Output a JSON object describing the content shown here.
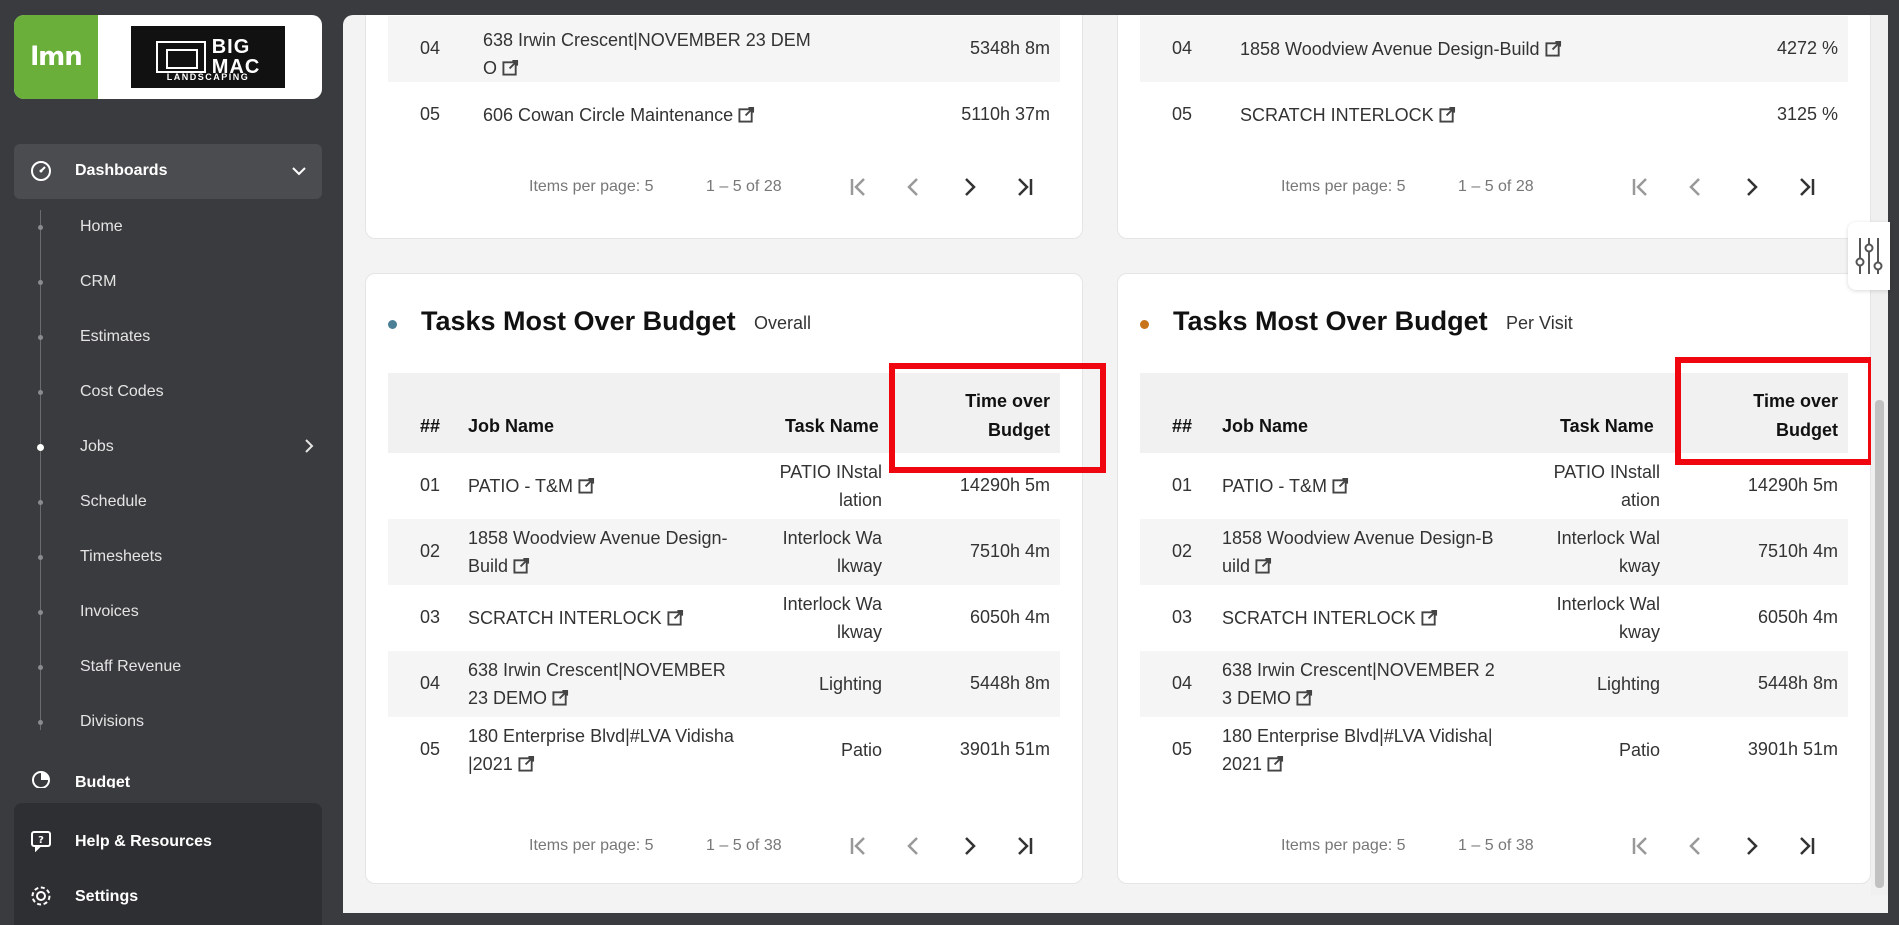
{
  "brand": {
    "lmn_logo": "lmn",
    "company_logo_line1": "BIG",
    "company_logo_line2": "MAC",
    "company_logo_sub": "LANDSCAPING"
  },
  "sidebar": {
    "dashboards_label": "Dashboards",
    "items": [
      {
        "label": "Home"
      },
      {
        "label": "CRM"
      },
      {
        "label": "Estimates"
      },
      {
        "label": "Cost Codes"
      },
      {
        "label": "Jobs"
      },
      {
        "label": "Schedule"
      },
      {
        "label": "Timesheets"
      },
      {
        "label": "Invoices"
      },
      {
        "label": "Staff Revenue"
      },
      {
        "label": "Divisions"
      }
    ],
    "budget_label": "Budget",
    "help_label": "Help & Resources",
    "settings_label": "Settings"
  },
  "top_left": {
    "rows": [
      {
        "num": "04",
        "job_l1": "638 Irwin Crescent|NOVEMBER 23 DEM",
        "job_l2": "O",
        "value": "5348h 8m"
      },
      {
        "num": "05",
        "job": "606 Cowan Circle Maintenance",
        "value": "5110h 37m"
      }
    ],
    "pager": {
      "items_per_page": "Items per page: 5",
      "range": "1 – 5 of 28"
    }
  },
  "top_right": {
    "rows": [
      {
        "num": "04",
        "job": "1858 Woodview Avenue Design-Build",
        "value": "4272 %"
      },
      {
        "num": "05",
        "job": "SCRATCH INTERLOCK",
        "value": "3125 %"
      }
    ],
    "pager": {
      "items_per_page": "Items per page: 5",
      "range": "1 – 5 of 28"
    }
  },
  "overall": {
    "title": "Tasks Most Over Budget",
    "subtitle": "Overall",
    "dot_color": "#4a7f95",
    "headers": {
      "num": "##",
      "job": "Job Name",
      "task": "Task Name",
      "time_l1": "Time over",
      "time_l2": "Budget"
    },
    "rows": [
      {
        "num": "01",
        "job_l1": "PATIO - T&M",
        "job_l2": "",
        "task_l1": "PATIO INstal",
        "task_l2": "lation",
        "value": "14290h 5m"
      },
      {
        "num": "02",
        "job_l1": "1858 Woodview Avenue Design-",
        "job_l2": "Build",
        "task_l1": "Interlock Wa",
        "task_l2": "lkway",
        "value": "7510h 4m"
      },
      {
        "num": "03",
        "job_l1": "SCRATCH INTERLOCK",
        "job_l2": "",
        "task_l1": "Interlock Wa",
        "task_l2": "lkway",
        "value": "6050h 4m"
      },
      {
        "num": "04",
        "job_l1": "638 Irwin Crescent|NOVEMBER",
        "job_l2": "23 DEMO",
        "task_l1": "Lighting",
        "task_l2": "",
        "value": "5448h 8m"
      },
      {
        "num": "05",
        "job_l1": "180 Enterprise Blvd|#LVA Vidisha",
        "job_l2": "|2021",
        "task_l1": "Patio",
        "task_l2": "",
        "value": "3901h 51m"
      }
    ],
    "pager": {
      "items_per_page": "Items per page: 5",
      "range": "1 – 5 of 38"
    }
  },
  "per_visit": {
    "title": "Tasks Most Over Budget",
    "subtitle": "Per Visit",
    "dot_color": "#c8731a",
    "headers": {
      "num": "##",
      "job": "Job Name",
      "task": "Task Name",
      "time_l1": "Time over",
      "time_l2": "Budget"
    },
    "rows": [
      {
        "num": "01",
        "job_l1": "PATIO - T&M",
        "job_l2": "",
        "task_l1": "PATIO INstall",
        "task_l2": "ation",
        "value": "14290h 5m"
      },
      {
        "num": "02",
        "job_l1": "1858 Woodview Avenue Design-B",
        "job_l2": "uild",
        "task_l1": "Interlock Wal",
        "task_l2": "kway",
        "value": "7510h 4m"
      },
      {
        "num": "03",
        "job_l1": "SCRATCH INTERLOCK",
        "job_l2": "",
        "task_l1": "Interlock Wal",
        "task_l2": "kway",
        "value": "6050h 4m"
      },
      {
        "num": "04",
        "job_l1": "638 Irwin Crescent|NOVEMBER 2",
        "job_l2": "3 DEMO",
        "task_l1": "Lighting",
        "task_l2": "",
        "value": "5448h 8m"
      },
      {
        "num": "05",
        "job_l1": "180 Enterprise Blvd|#LVA Vidisha|",
        "job_l2": "2021",
        "task_l1": "Patio",
        "task_l2": "",
        "value": "3901h 51m"
      }
    ],
    "pager": {
      "items_per_page": "Items per page: 5",
      "range": "1 – 5 of 38"
    }
  },
  "colors": {
    "accent_green": "#6aaf3a",
    "highlight_red": "#f0060e",
    "sidebar_bg": "#3a3b3e"
  }
}
